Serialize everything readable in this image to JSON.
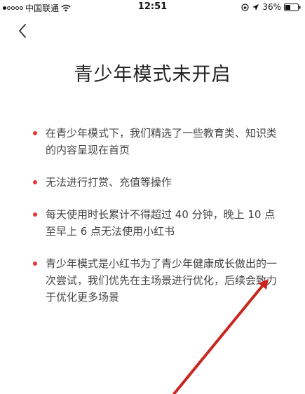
{
  "status_bar": {
    "carrier": "中国联通",
    "time": "12:51",
    "battery": "36%"
  },
  "header": {
    "back_icon": "chevron-left-icon"
  },
  "page": {
    "title": "青少年模式未开启"
  },
  "rules": [
    "在青少年模式下，我们精选了一些教育类、知识类的内容呈现在首页",
    "无法进行打赏、充值等操作",
    "每天使用时长累计不得超过 40 分钟，晚上 10 点至早上 6 点无法使用小红书",
    "青少年模式是小红书为了青少年健康成长做出的一次尝试，我们优先在主场景进行优化，后续会致力于优化更多场景"
  ],
  "colors": {
    "bullet": "#e5392f",
    "arrow": "#c8261e"
  }
}
